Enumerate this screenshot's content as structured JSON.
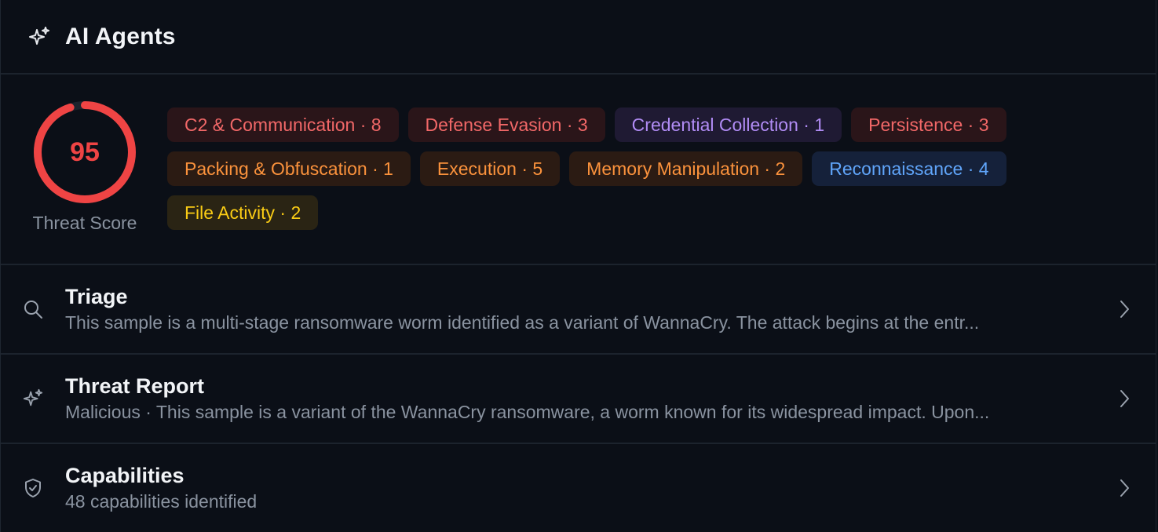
{
  "header": {
    "title": "AI Agents",
    "icon": "sparkles-icon"
  },
  "threat": {
    "score": "95",
    "score_fraction": 0.95,
    "label": "Threat Score",
    "color": "#ef4444"
  },
  "tags": [
    {
      "label": "C2 & Communication · 8",
      "color": "red"
    },
    {
      "label": "Defense Evasion · 3",
      "color": "red"
    },
    {
      "label": "Credential Collection · 1",
      "color": "purple"
    },
    {
      "label": "Persistence · 3",
      "color": "red"
    },
    {
      "label": "Packing & Obfuscation · 1",
      "color": "orange"
    },
    {
      "label": "Execution · 5",
      "color": "orange"
    },
    {
      "label": "Memory Manipulation · 2",
      "color": "orange"
    },
    {
      "label": "Reconnaissance · 4",
      "color": "blue"
    },
    {
      "label": "File Activity · 2",
      "color": "yellow"
    }
  ],
  "rows": [
    {
      "icon": "search-icon",
      "title": "Triage",
      "subtitle": "This sample is a multi-stage ransomware worm identified as a variant of WannaCry. The attack begins at the entr..."
    },
    {
      "icon": "sparkles-icon",
      "title": "Threat Report",
      "subtitle": "Malicious · This sample is a variant of the WannaCry ransomware, a worm known for its widespread impact. Upon..."
    },
    {
      "icon": "shield-check-icon",
      "title": "Capabilities",
      "subtitle": "48 capabilities identified"
    }
  ]
}
